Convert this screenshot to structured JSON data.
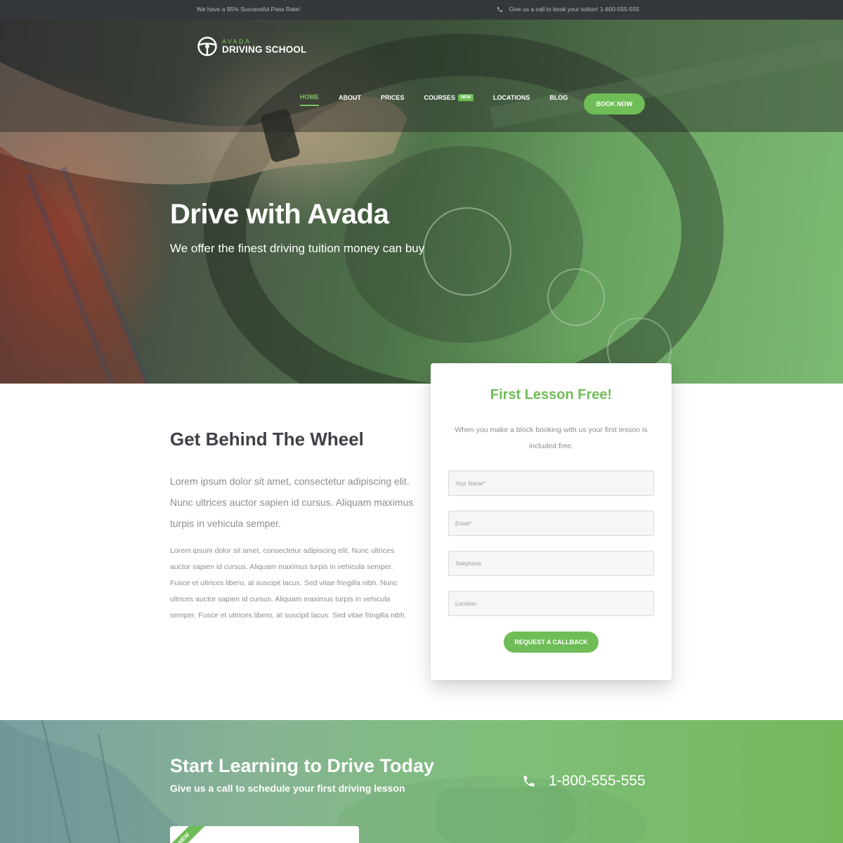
{
  "topbar": {
    "tagline": "We have a 95% Successful Pass Rate!",
    "call_text": "Give us a call to book your tuition! 1-800-555-555"
  },
  "logo": {
    "small": "AVADA",
    "big": "DRIVING SCHOOL"
  },
  "nav": {
    "items": [
      {
        "label": "HOME",
        "active": true
      },
      {
        "label": "ABOUT"
      },
      {
        "label": "PRICES"
      },
      {
        "label": "COURSES",
        "badge": "NEW"
      },
      {
        "label": "LOCATIONS"
      },
      {
        "label": "BLOG"
      }
    ],
    "cta_label": "BOOK NOW"
  },
  "hero": {
    "title": "Drive with Avada",
    "subtitle": "We offer the finest driving tuition money can buy"
  },
  "intro": {
    "title": "Get Behind The Wheel",
    "lead": "Lorem ipsum dolor sit amet, consectetur adipiscing elit. Nunc ultrices auctor sapien id cursus. Aliquam maximus turpis in vehicula semper.",
    "body": "Lorem ipsum dolor sit amet, consectetur adipiscing elit. Nunc ultrices auctor sapien id cursus. Aliquam maximus turpis in vehicula semper. Fusce et ultrices libero, at suscipit lacus. Sed vitae fringilla nibh. Nunc ultrices auctor sapien id cursus. Aliquam maximus turpis in vehicula semper. Fusce et ultrices libero, at suscipit lacus. Sed vitae fringilla nibh."
  },
  "form": {
    "title": "First Lesson Free!",
    "text": "When you make a block booking with us your first lesson is included free.",
    "name_placeholder": "Your Name*",
    "email_placeholder": "Email*",
    "telephone_placeholder": "Telephone",
    "location_placeholder": "Location",
    "submit_label": "REQUEST A CALLBACK"
  },
  "cta": {
    "title": "Start Learning to Drive Today",
    "subtitle": "Give us a call to schedule your first driving lesson",
    "phone": "1-800-555-555"
  },
  "course_card": {
    "ribbon": "NEW"
  },
  "colors": {
    "accent": "#6fbd56",
    "topbar": "#34373b",
    "text_heading": "#3e4147",
    "text_body": "#8a8d91"
  }
}
